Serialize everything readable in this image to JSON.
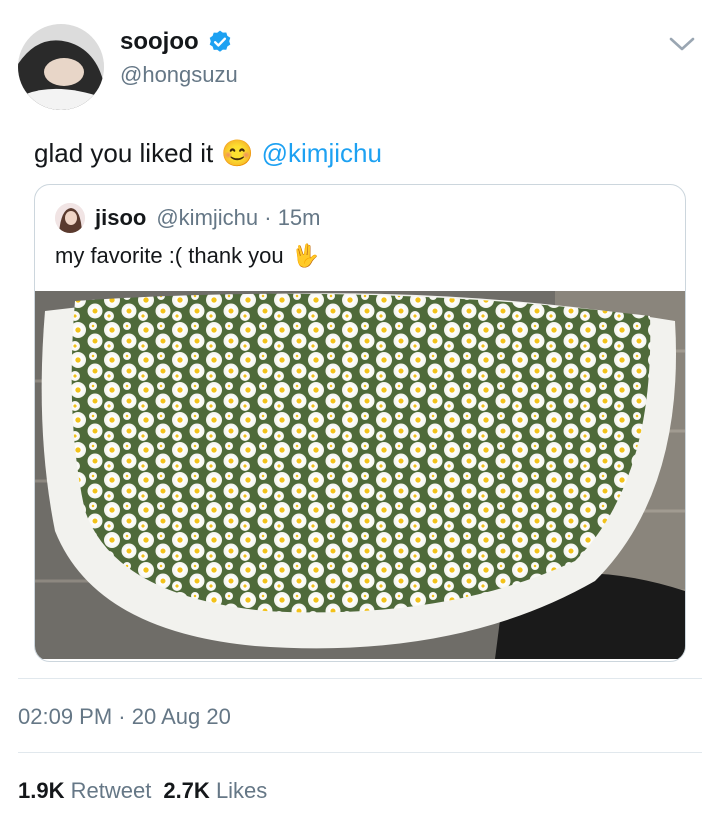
{
  "author": {
    "display_name": "soojoo",
    "handle": "@hongsuzu",
    "verified_color": "#1da1f2"
  },
  "tweet": {
    "text": "glad you liked it",
    "emoji": "😊",
    "mention": "@kimjichu"
  },
  "quoted": {
    "display_name": "jisoo",
    "meta": "@kimjichu · 15m",
    "text": "my favorite :( thank you",
    "emoji": "🖖",
    "image_icon": "daisy-bouquet-photo"
  },
  "timestamp": "02:09 PM · 20 Aug 20",
  "stats": {
    "retweets_count": "1.9K",
    "retweets_label": "Retweet",
    "likes_count": "2.7K",
    "likes_label": "Likes"
  },
  "colors": {
    "accent": "#1da1f2",
    "text_primary": "#14171a",
    "text_secondary": "#657786",
    "border": "#ccd6dd"
  }
}
